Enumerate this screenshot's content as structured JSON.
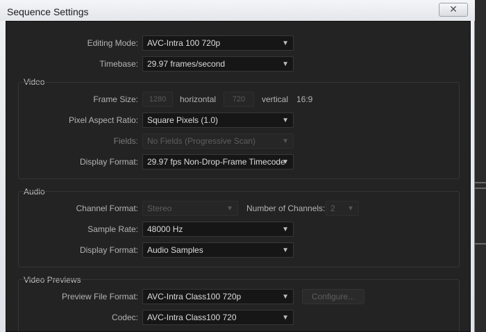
{
  "window": {
    "title": "Sequence Settings",
    "close_label": "✕"
  },
  "general": {
    "editing_mode_label": "Editing Mode:",
    "editing_mode_value": "AVC-Intra 100 720p",
    "timebase_label": "Timebase:",
    "timebase_value": "29.97  frames/second"
  },
  "video": {
    "section_title": "Video",
    "frame_size_label": "Frame Size:",
    "frame_width": "1280",
    "horizontal_label": "horizontal",
    "frame_height": "720",
    "vertical_label": "vertical",
    "aspect": "16:9",
    "pixel_aspect_label": "Pixel Aspect Ratio:",
    "pixel_aspect_value": "Square Pixels (1.0)",
    "fields_label": "Fields:",
    "fields_value": "No Fields (Progressive Scan)",
    "display_format_label": "Display Format:",
    "display_format_value": "29.97 fps Non-Drop-Frame Timecode"
  },
  "audio": {
    "section_title": "Audio",
    "channel_format_label": "Channel Format:",
    "channel_format_value": "Stereo",
    "num_channels_label": "Number of Channels:",
    "num_channels_value": "2",
    "sample_rate_label": "Sample Rate:",
    "sample_rate_value": "48000 Hz",
    "display_format_label": "Display Format:",
    "display_format_value": "Audio Samples"
  },
  "previews": {
    "section_title": "Video Previews",
    "file_format_label": "Preview File Format:",
    "file_format_value": "AVC-Intra Class100 720p",
    "configure_label": "Configure...",
    "codec_label": "Codec:",
    "codec_value": "AVC-Intra Class100 720"
  }
}
